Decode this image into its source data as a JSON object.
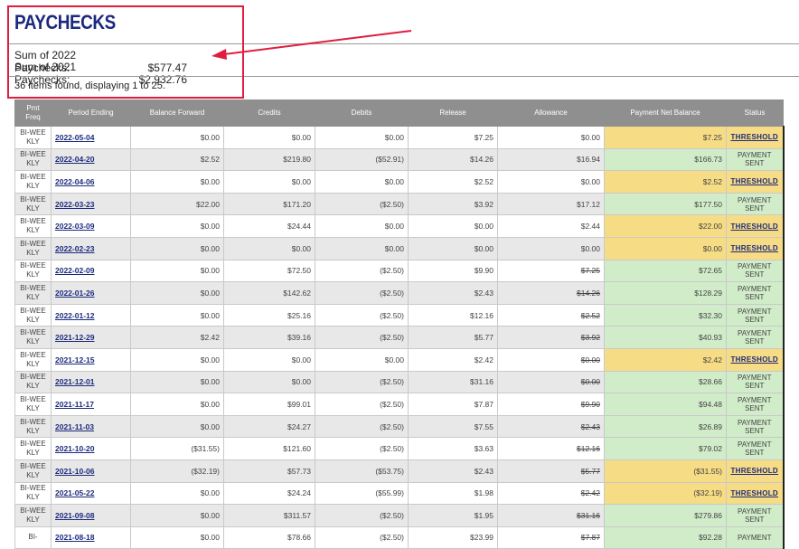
{
  "page_title": "PAYCHECKS",
  "sums": [
    {
      "label": "Sum of 2022 Paychecks:",
      "value": "$577.47"
    },
    {
      "label": "Sum of 2021 Paychecks:",
      "value": "$2,932.76"
    }
  ],
  "items_found": "36 items found, displaying 1 to 25.",
  "columns": {
    "pmt_freq": "Pmt Freq",
    "period_ending": "Period Ending",
    "balance_forward": "Balance Forward",
    "credits": "Credits",
    "debits": "Debits",
    "release": "Release",
    "allowance": "Allowance",
    "payment_net_balance": "Payment Net Balance",
    "status": "Status"
  },
  "colors": {
    "threshold": "#f6dc84",
    "sent": "#d1ecc9",
    "title": "#1c2a7d",
    "annotation": "#e01d3f"
  },
  "rows": [
    {
      "freq": "BI-WEEKLY",
      "period": "2022-05-04",
      "balance": "$0.00",
      "credits": "$0.00",
      "debits": "$0.00",
      "release": "$7.25",
      "allowance": "$0.00",
      "allowance_struck": false,
      "net": "$7.25",
      "status": "THRESHOLD",
      "state": "thr"
    },
    {
      "freq": "BI-WEEKLY",
      "period": "2022-04-20",
      "balance": "$2.52",
      "credits": "$219.80",
      "debits": "($52.91)",
      "release": "$14.26",
      "allowance": "$16.94",
      "allowance_struck": false,
      "net": "$166.73",
      "status": "PAYMENT SENT",
      "state": "sent"
    },
    {
      "freq": "BI-WEEKLY",
      "period": "2022-04-06",
      "balance": "$0.00",
      "credits": "$0.00",
      "debits": "$0.00",
      "release": "$2.52",
      "allowance": "$0.00",
      "allowance_struck": false,
      "net": "$2.52",
      "status": "THRESHOLD",
      "state": "thr"
    },
    {
      "freq": "BI-WEEKLY",
      "period": "2022-03-23",
      "balance": "$22.00",
      "credits": "$171.20",
      "debits": "($2.50)",
      "release": "$3.92",
      "allowance": "$17.12",
      "allowance_struck": false,
      "net": "$177.50",
      "status": "PAYMENT SENT",
      "state": "sent"
    },
    {
      "freq": "BI-WEEKLY",
      "period": "2022-03-09",
      "balance": "$0.00",
      "credits": "$24.44",
      "debits": "$0.00",
      "release": "$0.00",
      "allowance": "$2.44",
      "allowance_struck": false,
      "net": "$22.00",
      "status": "THRESHOLD",
      "state": "thr"
    },
    {
      "freq": "BI-WEEKLY",
      "period": "2022-02-23",
      "balance": "$0.00",
      "credits": "$0.00",
      "debits": "$0.00",
      "release": "$0.00",
      "allowance": "$0.00",
      "allowance_struck": false,
      "net": "$0.00",
      "status": "THRESHOLD",
      "state": "thr"
    },
    {
      "freq": "BI-WEEKLY",
      "period": "2022-02-09",
      "balance": "$0.00",
      "credits": "$72.50",
      "debits": "($2.50)",
      "release": "$9.90",
      "allowance": "$7.25",
      "allowance_struck": true,
      "net": "$72.65",
      "status": "PAYMENT SENT",
      "state": "sent"
    },
    {
      "freq": "BI-WEEKLY",
      "period": "2022-01-26",
      "balance": "$0.00",
      "credits": "$142.62",
      "debits": "($2.50)",
      "release": "$2.43",
      "allowance": "$14.26",
      "allowance_struck": true,
      "net": "$128.29",
      "status": "PAYMENT SENT",
      "state": "sent"
    },
    {
      "freq": "BI-WEEKLY",
      "period": "2022-01-12",
      "balance": "$0.00",
      "credits": "$25.16",
      "debits": "($2.50)",
      "release": "$12.16",
      "allowance": "$2.52",
      "allowance_struck": true,
      "net": "$32.30",
      "status": "PAYMENT SENT",
      "state": "sent"
    },
    {
      "freq": "BI-WEEKLY",
      "period": "2021-12-29",
      "balance": "$2.42",
      "credits": "$39.16",
      "debits": "($2.50)",
      "release": "$5.77",
      "allowance": "$3.92",
      "allowance_struck": true,
      "net": "$40.93",
      "status": "PAYMENT SENT",
      "state": "sent"
    },
    {
      "freq": "BI-WEEKLY",
      "period": "2021-12-15",
      "balance": "$0.00",
      "credits": "$0.00",
      "debits": "$0.00",
      "release": "$2.42",
      "allowance": "$0.00",
      "allowance_struck": true,
      "net": "$2.42",
      "status": "THRESHOLD",
      "state": "thr"
    },
    {
      "freq": "BI-WEEKLY",
      "period": "2021-12-01",
      "balance": "$0.00",
      "credits": "$0.00",
      "debits": "($2.50)",
      "release": "$31.16",
      "allowance": "$0.00",
      "allowance_struck": true,
      "net": "$28.66",
      "status": "PAYMENT SENT",
      "state": "sent"
    },
    {
      "freq": "BI-WEEKLY",
      "period": "2021-11-17",
      "balance": "$0.00",
      "credits": "$99.01",
      "debits": "($2.50)",
      "release": "$7.87",
      "allowance": "$9.90",
      "allowance_struck": true,
      "net": "$94.48",
      "status": "PAYMENT SENT",
      "state": "sent"
    },
    {
      "freq": "BI-WEEKLY",
      "period": "2021-11-03",
      "balance": "$0.00",
      "credits": "$24.27",
      "debits": "($2.50)",
      "release": "$7.55",
      "allowance": "$2.43",
      "allowance_struck": true,
      "net": "$26.89",
      "status": "PAYMENT SENT",
      "state": "sent"
    },
    {
      "freq": "BI-WEEKLY",
      "period": "2021-10-20",
      "balance": "($31.55)",
      "credits": "$121.60",
      "debits": "($2.50)",
      "release": "$3.63",
      "allowance": "$12.16",
      "allowance_struck": true,
      "net": "$79.02",
      "status": "PAYMENT SENT",
      "state": "sent"
    },
    {
      "freq": "BI-WEEKLY",
      "period": "2021-10-06",
      "balance": "($32.19)",
      "credits": "$57.73",
      "debits": "($53.75)",
      "release": "$2.43",
      "allowance": "$5.77",
      "allowance_struck": true,
      "net": "($31.55)",
      "status": "THRESHOLD",
      "state": "thr"
    },
    {
      "freq": "BI-WEEKLY",
      "period": "2021-05-22",
      "balance": "$0.00",
      "credits": "$24.24",
      "debits": "($55.99)",
      "release": "$1.98",
      "allowance": "$2.42",
      "allowance_struck": true,
      "net": "($32.19)",
      "status": "THRESHOLD",
      "state": "thr"
    },
    {
      "freq": "BI-WEEKLY",
      "period": "2021-09-08",
      "balance": "$0.00",
      "credits": "$311.57",
      "debits": "($2.50)",
      "release": "$1.95",
      "allowance": "$31.16",
      "allowance_struck": true,
      "net": "$279.86",
      "status": "PAYMENT SENT",
      "state": "sent"
    },
    {
      "freq": "BI-",
      "period": "2021-08-18",
      "balance": "$0.00",
      "credits": "$78.66",
      "debits": "($2.50)",
      "release": "$23.99",
      "allowance": "$7.87",
      "allowance_struck": true,
      "net": "$92.28",
      "status": "PAYMENT",
      "state": "sent"
    }
  ]
}
